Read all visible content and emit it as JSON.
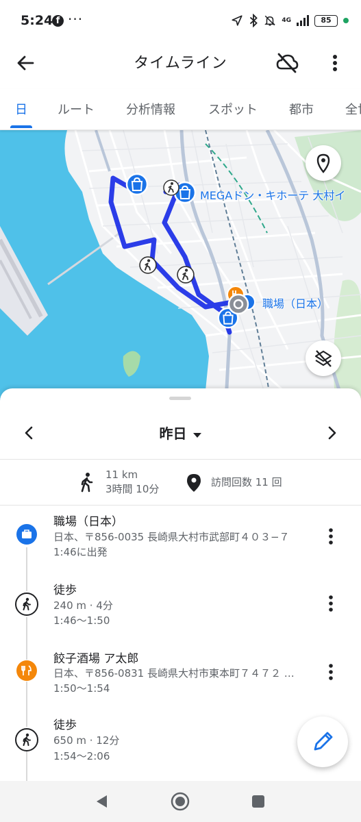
{
  "status_bar": {
    "time": "5:24",
    "app_icon": "facebook-icon",
    "overflow": "···",
    "network": "4G",
    "battery": "85"
  },
  "app_bar": {
    "title": "タイムライン",
    "back_icon": "arrow-back-icon",
    "cloud_icon": "cloud-off-icon",
    "menu_icon": "more-vert-icon"
  },
  "tabs": [
    {
      "label": "日",
      "active": true
    },
    {
      "label": "ルート",
      "active": false
    },
    {
      "label": "分析情報",
      "active": false
    },
    {
      "label": "スポット",
      "active": false
    },
    {
      "label": "都市",
      "active": false
    },
    {
      "label": "全世",
      "active": false
    }
  ],
  "map": {
    "labels": {
      "store": "MEGAドン・キホーテ 大村イ",
      "work": "職場（日本）"
    },
    "colors": {
      "water": "#4fc1e9",
      "land": "#f2f3f5",
      "route": "#1a2ee6",
      "pin": "#1a73e8",
      "food": "#f4870a"
    }
  },
  "day_nav": {
    "date": "昨日",
    "prev_icon": "chevron-left-icon",
    "next_icon": "chevron-right-icon"
  },
  "summary": {
    "distance": "11 km",
    "duration": "3時間 10分",
    "visits": "訪問回数 11 回"
  },
  "timeline": [
    {
      "type": "place",
      "icon": "briefcase-icon",
      "title": "職場（日本）",
      "line1": "日本、〒856-0035 長崎県大村市武部町４０３−７",
      "line2": "1:46に出発"
    },
    {
      "type": "walk",
      "icon": "walking-icon",
      "title": "徒歩",
      "line1": "240 m · 4分",
      "line2": "1:46〜1:50"
    },
    {
      "type": "place",
      "icon": "restaurant-icon",
      "title": "餃子酒場 ア太郎",
      "line1": "日本、〒856-0831 長崎県大村市東本町７４７２ …",
      "line2": "1:50〜1:54"
    },
    {
      "type": "walk",
      "icon": "walking-icon",
      "title": "徒歩",
      "line1": "650 m · 12分",
      "line2": "1:54〜2:06"
    }
  ]
}
